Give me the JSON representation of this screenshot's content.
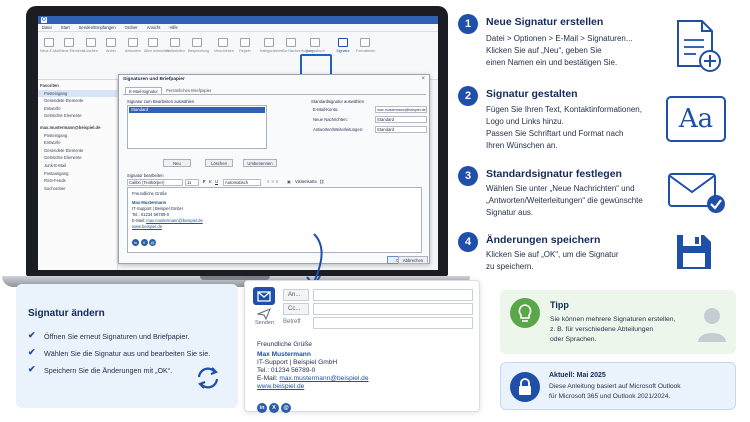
{
  "outlook": {
    "menu": [
      "Datei",
      "Start",
      "Senden/Empfangen",
      "Ordner",
      "Ansicht",
      "Hilfe"
    ],
    "ribbon": [
      "Neue E-Mail",
      "Neue Elemente",
      "Löschen",
      "Archiv",
      "Antworten",
      "Allen antworten",
      "Weiterleiten",
      "Besprechung",
      "Verschieben",
      "Regeln",
      "Kategorisieren",
      "Zur Nachverfolgung",
      "Adressbuch",
      "Signatur",
      "Formatieren"
    ],
    "nav_favorites_header": "Favoriten",
    "nav_favorites": [
      "Posteingang",
      "Gesendete Elemente",
      "Entwürfe",
      "Gelöschte Elemente"
    ],
    "nav_account_header": "max.mustermann@beispiel.de",
    "nav_account": [
      "Posteingang",
      "Entwürfe",
      "Gesendete Elemente",
      "Gelöschte Elemente",
      "Junk-E-Mail",
      "Postausgang",
      "RSS-Feeds",
      "Suchordner"
    ],
    "dialog": {
      "title": "Signaturen und Briefpapier",
      "tabs": [
        "E-Mail-Signatur",
        "Persönliches Briefpapier"
      ],
      "select_label": "Signatur zum Bearbeiten auswählen",
      "list_item": "Standard",
      "buttons": [
        "Neu",
        "Löschen",
        "Umbenennen"
      ],
      "defaults_label": "Standardsignatur auswählen",
      "account_label": "E-Mail-Konto:",
      "account_value": "max.mustermann@beispiel.de",
      "new_label": "Neue Nachrichten:",
      "new_value": "Standard",
      "reply_label": "Antworten/Weiterleitungen:",
      "reply_value": "Standard",
      "edit_label": "Signatur bearbeiten",
      "font": "Calibri (Textkörper)",
      "size": "11",
      "color": "Automatisch",
      "vcard": "Visitenkarte",
      "ok": "OK",
      "cancel": "Abbrechen"
    }
  },
  "signature": {
    "greeting": "Freundliche Grüße",
    "name": "Max Mustermann",
    "company": "IT-Support | Beispiel GmbH",
    "phone": "Tel.: 01234 56789-0",
    "email_label": "E-Mail:",
    "email": "max.mustermann@beispiel.de",
    "web": "www.beispiel.de",
    "social": [
      "in",
      "X",
      "@"
    ]
  },
  "steps": [
    {
      "num": "1",
      "title": "Neue Signatur erstellen",
      "lines": [
        "Datei > Optionen > E-Mail > Signaturen...",
        "Klicken Sie auf „Neu“, geben Sie",
        "einen Namen ein und bestätigen Sie."
      ],
      "icon": "document-plus-icon"
    },
    {
      "num": "2",
      "title": "Signatur gestalten",
      "lines": [
        "Fügen Sie Ihren Text, Kontaktinformationen,",
        "Logo und Links hinzu.",
        "Passen Sie Schriftart und Format nach",
        "Ihren Wünschen an."
      ],
      "icon": "font-aa-icon",
      "icon_text": "Aa"
    },
    {
      "num": "3",
      "title": "Standardsignatur festlegen",
      "lines": [
        "Wählen Sie unter „Neue Nachrichten“ und",
        "„Antworten/Weiterleitungen“ die gewünschte",
        "Signatur aus."
      ],
      "icon": "envelope-check-icon"
    },
    {
      "num": "4",
      "title": "Änderungen speichern",
      "lines": [
        "Klicken Sie auf „OK“, um die Signatur",
        "zu speichern."
      ],
      "icon": "floppy-disk-icon"
    }
  ],
  "change_panel": {
    "title": "Signatur ändern",
    "items": [
      "Öffnen Sie erneut Signaturen und Briefpapier.",
      "Wählen Sie die Signatur aus und bearbeiten Sie sie.",
      "Speichern Sie die Änderungen mit „OK“."
    ]
  },
  "compose": {
    "to": "An...",
    "cc": "Cc...",
    "subject": "Betreff",
    "send": "Senden"
  },
  "tipp": {
    "title": "Tipp",
    "lines": [
      "Sie können mehrere Signaturen erstellen,",
      "z. B. für verschiedene Abteilungen",
      "oder Sprachen."
    ]
  },
  "aktuell": {
    "title": "Aktuell: Mai 2025",
    "lines": [
      "Diese Anleitung basiert auf Microsoft Outlook",
      "für Microsoft 365 und Outlook 2021/2024."
    ]
  },
  "colors": {
    "accent": "#1f4fa8",
    "dark": "#142a5c",
    "panel": "#eaf2fb",
    "tipp": "#edf6ea"
  }
}
